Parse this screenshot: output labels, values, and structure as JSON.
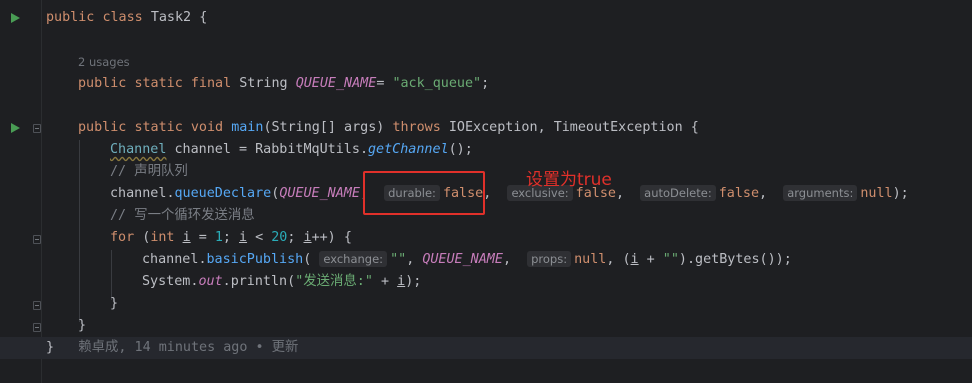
{
  "code": {
    "l1": {
      "kw1": "public",
      "kw2": "class",
      "name": "Task2",
      "brace": "{"
    },
    "usages": "2 usages",
    "l3": {
      "kw1": "public",
      "kw2": "static",
      "kw3": "final",
      "type": "String",
      "const": "QUEUE_NAME",
      "eq": "=",
      "str": "\"ack_queue\"",
      "end": ";"
    },
    "l4": {
      "kw1": "public",
      "kw2": "static",
      "kw3": "void",
      "method": "main",
      "p_open": "(",
      "p_type": "String",
      "p_rest": "[] args)",
      "throws": "throws",
      "ex1": "IOException",
      "comma": ",",
      "ex2": "TimeoutException",
      "brace": "{"
    },
    "l5": {
      "type": "Channel",
      "var": "channel",
      "eq": "=",
      "cls": "RabbitMqUtils",
      "dot": ".",
      "method": "getChannel",
      "end": "();"
    },
    "l6": {
      "comment": "// 声明队列"
    },
    "l7": {
      "obj": "channel",
      "dot": ".",
      "method": "queueDeclare",
      "open": "(",
      "const": "QUEUE_NAME",
      "comma": ",",
      "hint1": "durable:",
      "v1": "false",
      "hint2": "exclusive:",
      "v2": "false",
      "hint3": "autoDelete:",
      "v3": "false",
      "hint4": "arguments:",
      "v4": "null",
      "end": ");"
    },
    "l8": {
      "comment": "// 写一个循环发送消息"
    },
    "l9": {
      "kw": "for",
      "open": "(",
      "int": "int",
      "i": "i",
      "eq": "=",
      "one": "1",
      "semi": ";",
      "i2": "i",
      "lt": "<",
      "twenty": "20",
      "semi2": ";",
      "i3": "i",
      "inc": "++)",
      "brace": "{"
    },
    "l10": {
      "obj": "channel",
      "dot": ".",
      "method": "basicPublish",
      "open": "(",
      "hint1": "exchange:",
      "str1": "\"\"",
      "comma": ",",
      "const": "QUEUE_NAME",
      "comma2": ",",
      "hint2": "props:",
      "nul": "null",
      "comma3": ",",
      "p_open": "(",
      "i": "i",
      "plus": "+",
      "str2": "\"\"",
      "p_close": ").",
      "method2": "getBytes",
      "end": "());"
    },
    "l11": {
      "cls": "System",
      "dot": ".",
      "field": "out",
      "dot2": ".",
      "method": "println",
      "open": "(",
      "str": "\"发送消息:\"",
      "plus": "+",
      "i": "i",
      "end": ");"
    },
    "l12": "}",
    "l13": "}",
    "l14": {
      "brace": "}",
      "blame": "赖卓成, 14 minutes ago • 更新"
    }
  },
  "annotation": {
    "text": "设置为true",
    "color": "#e0302a"
  },
  "icons": {
    "run": "run-icon",
    "fold": "fold-icon"
  },
  "colors": {
    "background": "#1e1f22",
    "keyword": "#cf8e6d",
    "string": "#6aab73",
    "constant": "#c77dbb",
    "method": "#56a8f5"
  }
}
